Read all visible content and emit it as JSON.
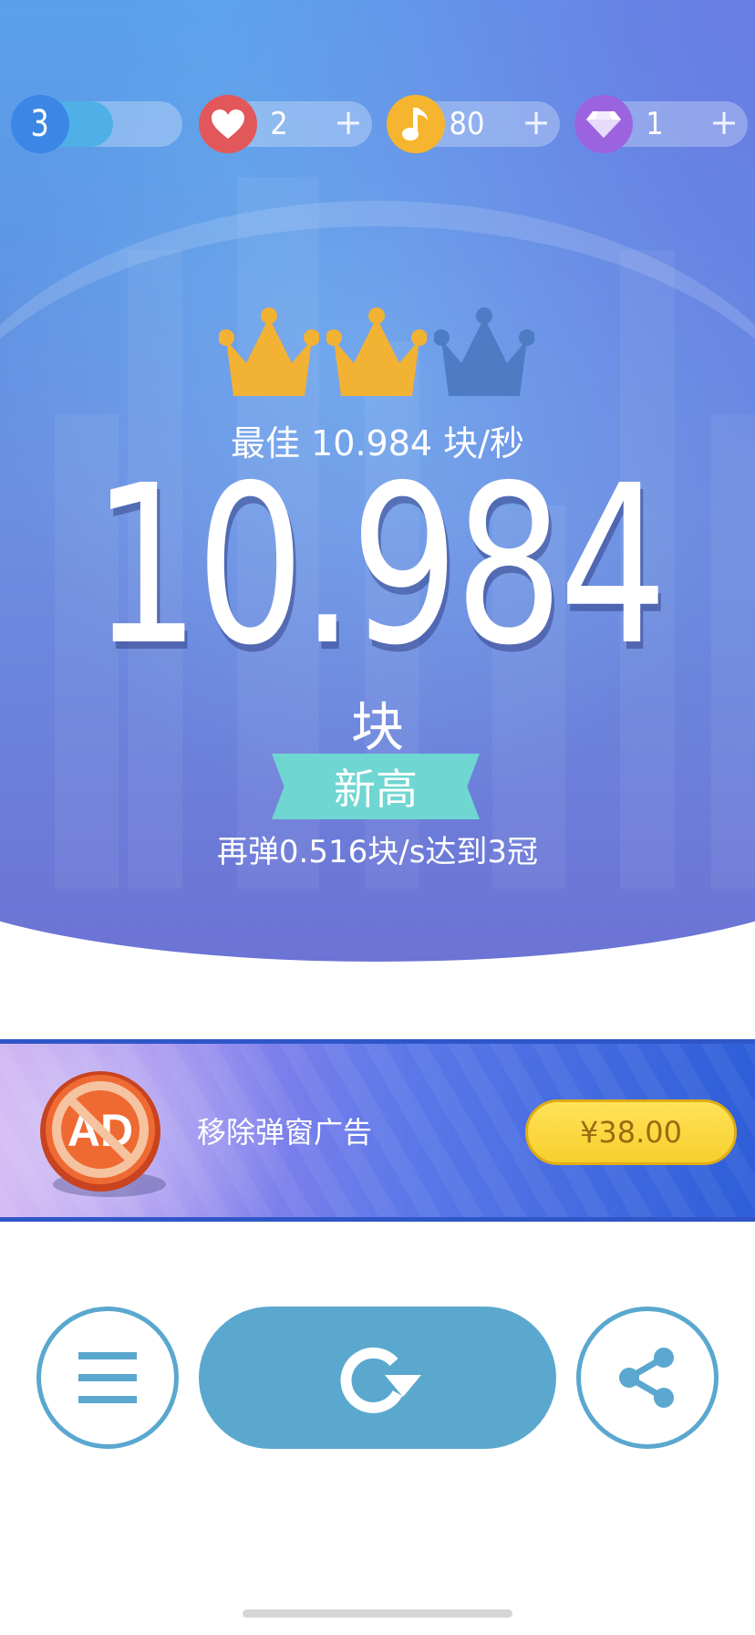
{
  "top_bar": {
    "level": {
      "value": "3",
      "progress": 0.38,
      "color": "#3c86e6"
    },
    "lives": {
      "value": "2",
      "plus": "+",
      "icon": "heart-icon",
      "color": "#e2575a"
    },
    "notes": {
      "value": "80",
      "plus": "+",
      "icon": "music-note-icon",
      "color": "#f6b52e"
    },
    "diamonds": {
      "value": "1",
      "plus": "+",
      "icon": "diamond-icon",
      "color": "#9c63df"
    }
  },
  "result": {
    "crowns_earned": 2,
    "crowns_total": 3,
    "best_line": "最佳 10.984 块/秒",
    "score": "10.984",
    "unit": "块",
    "badge": "新高",
    "hint": "再弹0.516块/s达到3冠"
  },
  "ad_banner": {
    "icon_text": "AD",
    "text": "移除弹窗广告",
    "price": "¥38.00"
  },
  "controls": {
    "menu": "menu-icon",
    "replay": "replay-icon",
    "share": "share-icon"
  },
  "colors": {
    "crown_gold": "#f2b233",
    "crown_dim": "#4d7bc4",
    "accent_blue": "#5aa7cf",
    "badge_teal": "#6fd6d2"
  }
}
